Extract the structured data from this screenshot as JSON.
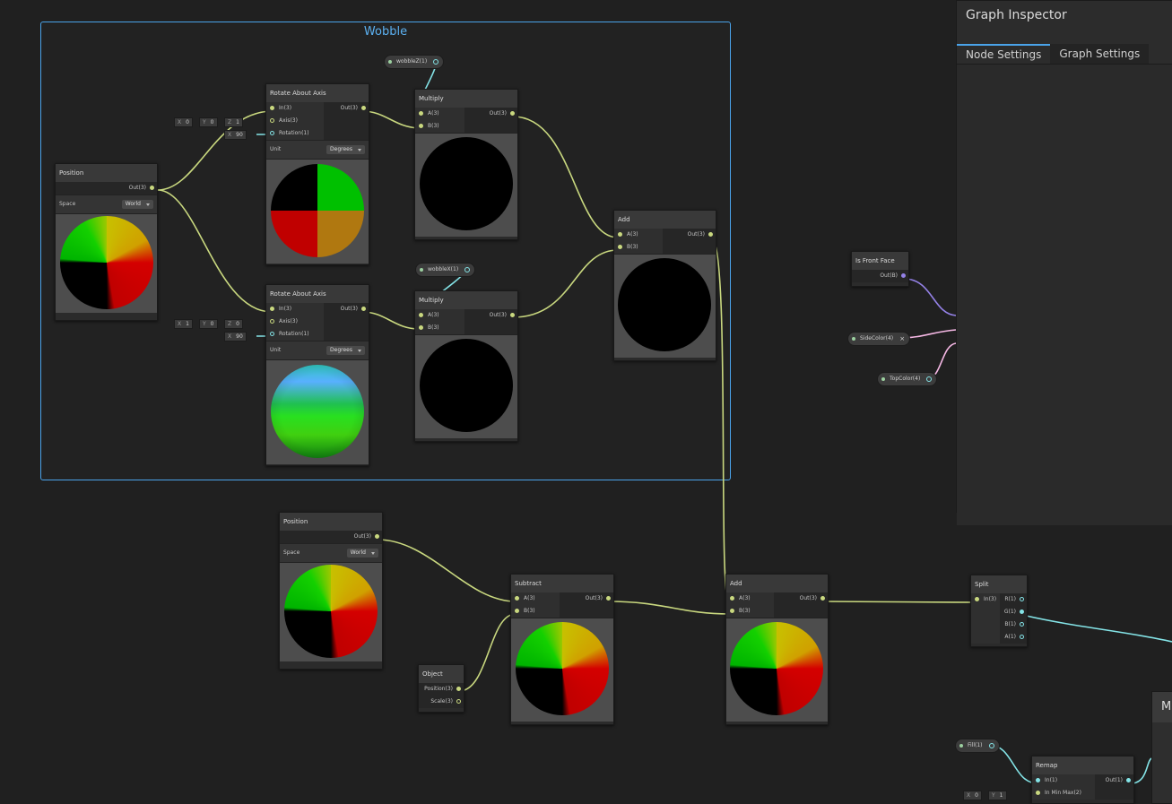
{
  "group": {
    "title": "Wobble"
  },
  "inspector": {
    "title": "Graph Inspector",
    "tabs": [
      {
        "label": "Node Settings",
        "active": true
      },
      {
        "label": "Graph Settings",
        "active": false
      }
    ]
  },
  "nodes": {
    "position1": {
      "title": "Position",
      "out": "Out(3)",
      "space_label": "Space",
      "space_value": "World"
    },
    "rotate1": {
      "title": "Rotate About Axis",
      "in": [
        "In(3)",
        "Axis(3)",
        "Rotation(1)"
      ],
      "out": "Out(3)",
      "unit_label": "Unit",
      "unit_value": "Degrees"
    },
    "rotate2": {
      "title": "Rotate About Axis",
      "in": [
        "In(3)",
        "Axis(3)",
        "Rotation(1)"
      ],
      "out": "Out(3)",
      "unit_label": "Unit",
      "unit_value": "Degrees"
    },
    "multiply1": {
      "title": "Multiply",
      "in": [
        "A(3)",
        "B(3)"
      ],
      "out": "Out(3)"
    },
    "multiply2": {
      "title": "Multiply",
      "in": [
        "A(3)",
        "B(3)"
      ],
      "out": "Out(3)"
    },
    "add1": {
      "title": "Add",
      "in": [
        "A(3)",
        "B(3)"
      ],
      "out": "Out(3)"
    },
    "position2": {
      "title": "Position",
      "out": "Out(3)",
      "space_label": "Space",
      "space_value": "World"
    },
    "subtract": {
      "title": "Subtract",
      "in": [
        "A(3)",
        "B(3)"
      ],
      "out": "Out(3)"
    },
    "object": {
      "title": "Object",
      "out": [
        "Position(3)",
        "Scale(3)"
      ]
    },
    "add2": {
      "title": "Add",
      "in": [
        "A(3)",
        "B(3)"
      ],
      "out": "Out(3)"
    },
    "split": {
      "title": "Split",
      "in": "In(3)",
      "out": [
        "R(1)",
        "G(1)",
        "B(1)",
        "A(1)"
      ]
    },
    "isfrontface": {
      "title": "Is Front Face",
      "out": "Out(B)"
    },
    "remap": {
      "title": "Remap",
      "in": [
        "In(1)",
        "In Min Max(2)"
      ],
      "out": "Out(1)"
    },
    "master": {
      "title": "M"
    }
  },
  "properties": {
    "wobbleZ": "wobbleZ(1)",
    "wobbleX": "wobbleX(1)",
    "sideColor": "SideColor(4)",
    "topColor": "TopColor(4)",
    "fill": "Fill(1)"
  },
  "inputs": {
    "rot1_axis": [
      {
        "k": "X",
        "v": "0"
      },
      {
        "k": "Y",
        "v": "0"
      },
      {
        "k": "Z",
        "v": "1"
      }
    ],
    "rot1_rotation": {
      "k": "X",
      "v": "90"
    },
    "rot2_axis": [
      {
        "k": "X",
        "v": "1"
      },
      {
        "k": "Y",
        "v": "0"
      },
      {
        "k": "Z",
        "v": "0"
      }
    ],
    "rot2_rotation": {
      "k": "X",
      "v": "90"
    },
    "remap_minmax": [
      {
        "k": "X",
        "v": "0"
      },
      {
        "k": "Y",
        "v": "1"
      }
    ]
  },
  "colors": {
    "accent": "#4aa3ea",
    "wire_vec3": "#c9d87f",
    "wire_float": "#84e4e7",
    "wire_bool": "#9481e6",
    "wire_color": "#f6b8e5"
  }
}
